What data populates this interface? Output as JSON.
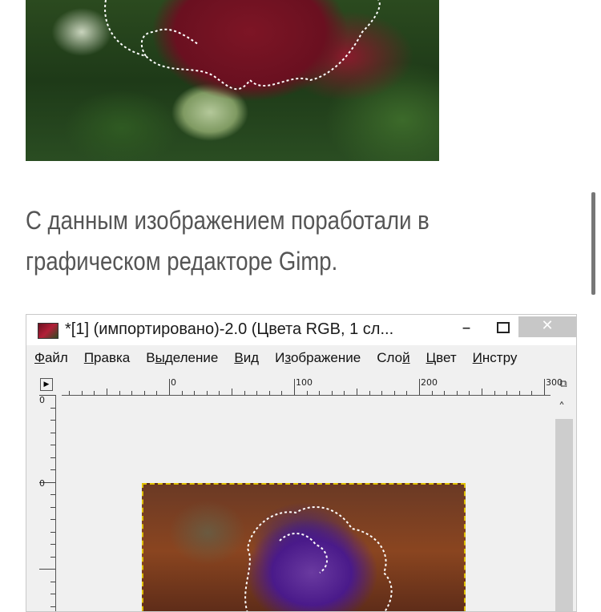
{
  "caption": {
    "line1": "С данным изображением поработали в",
    "line2": "графическом редакторе Gimp."
  },
  "gimp_window": {
    "title": "*[1] (импортировано)-2.0 (Цвета RGB, 1 сл...",
    "minimize_glyph": "–",
    "close_glyph": "✕",
    "menu": [
      {
        "pre": "",
        "u": "Ф",
        "post": "айл"
      },
      {
        "pre": "",
        "u": "П",
        "post": "равка"
      },
      {
        "pre": "В",
        "u": "ы",
        "post": "деление"
      },
      {
        "pre": "",
        "u": "В",
        "post": "ид"
      },
      {
        "pre": "И",
        "u": "з",
        "post": "ображение"
      },
      {
        "pre": "Сло",
        "u": "й",
        "post": ""
      },
      {
        "pre": "",
        "u": "Ц",
        "post": "вет"
      },
      {
        "pre": "",
        "u": "И",
        "post": "нстру"
      }
    ],
    "ruler_top_labels": [
      "0",
      "100",
      "200",
      "300"
    ],
    "ruler_left_labels": [
      "0",
      "0"
    ],
    "scroll_up_glyph": "˄",
    "nav_glyph": "▶",
    "zoom_glyph": "⧉"
  },
  "colors": {
    "selection_marching_ants": "#e0c000",
    "window_bg": "#f0f0f0",
    "caption_text": "#555555"
  }
}
